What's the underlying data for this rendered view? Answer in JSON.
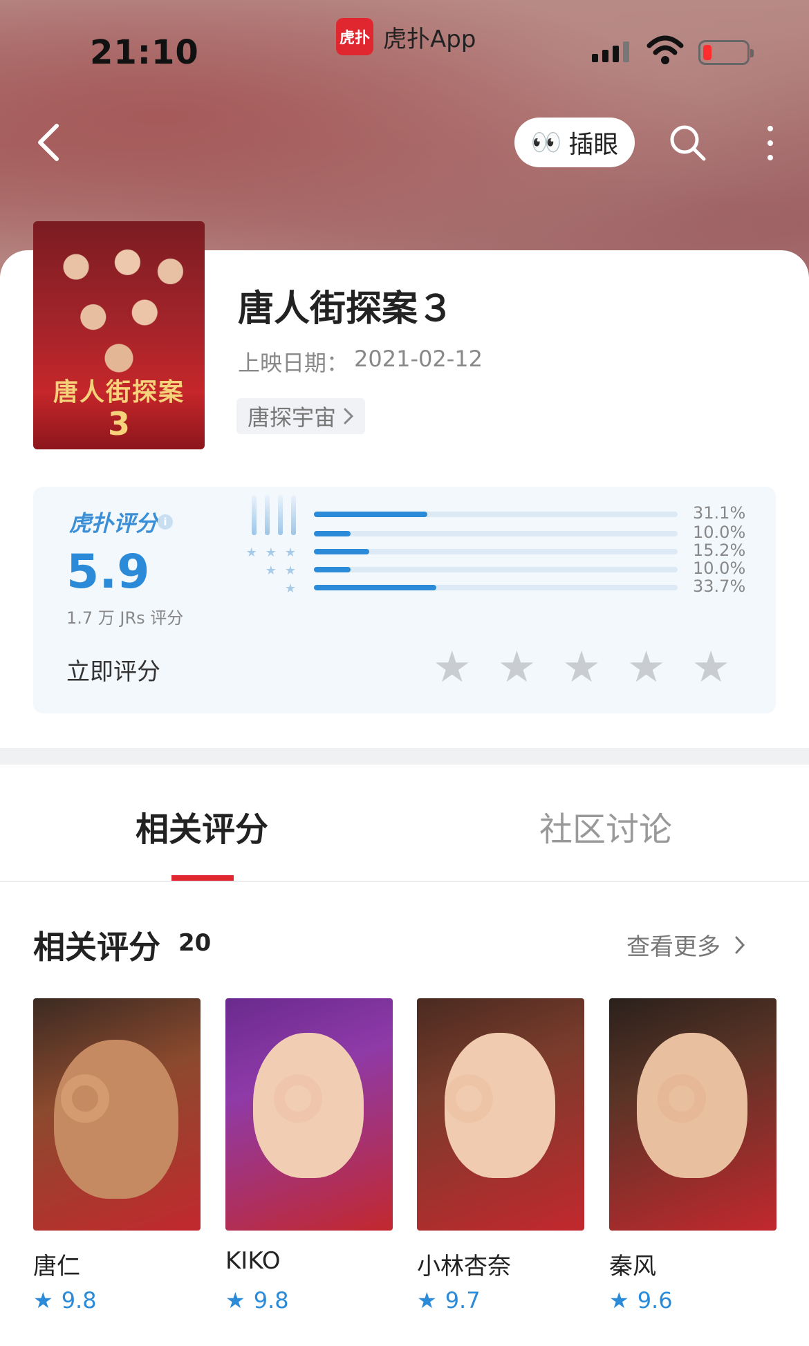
{
  "status": {
    "time": "21:10",
    "app_logo": "虎扑",
    "app_name": "虎扑App"
  },
  "nav": {
    "peek_icon": "👀",
    "peek_label": "插眼"
  },
  "movie": {
    "title": "唐人街探案３",
    "release_label": "上映日期：",
    "release_date": "2021-02-12",
    "tag": "唐探宇宙",
    "poster_text": "唐人街探案",
    "poster_num": "3"
  },
  "rating": {
    "brand": "虎扑评分",
    "score": "5.9",
    "count": "1.7 万 JRs 评分",
    "rate_now": "立即评分",
    "distribution": [
      {
        "stars": 5,
        "percent": 31.1,
        "label": "31.1%"
      },
      {
        "stars": 4,
        "percent": 10.0,
        "label": "10.0%"
      },
      {
        "stars": 3,
        "percent": 15.2,
        "label": "15.2%"
      },
      {
        "stars": 2,
        "percent": 10.0,
        "label": "10.0%"
      },
      {
        "stars": 1,
        "percent": 33.7,
        "label": "33.7%"
      }
    ]
  },
  "tabs": {
    "active": "相关评分",
    "inactive": "社区讨论"
  },
  "related": {
    "title": "相关评分",
    "count": "20",
    "see_more": "查看更多",
    "people": [
      {
        "name": "唐仁",
        "score": "9.8"
      },
      {
        "name": "KIKO",
        "score": "9.8"
      },
      {
        "name": "小林杏奈",
        "score": "9.7"
      },
      {
        "name": "秦风",
        "score": "9.6"
      }
    ]
  },
  "colors": {
    "brand_red": "#e0262e",
    "accent_blue": "#2b8bd8"
  }
}
